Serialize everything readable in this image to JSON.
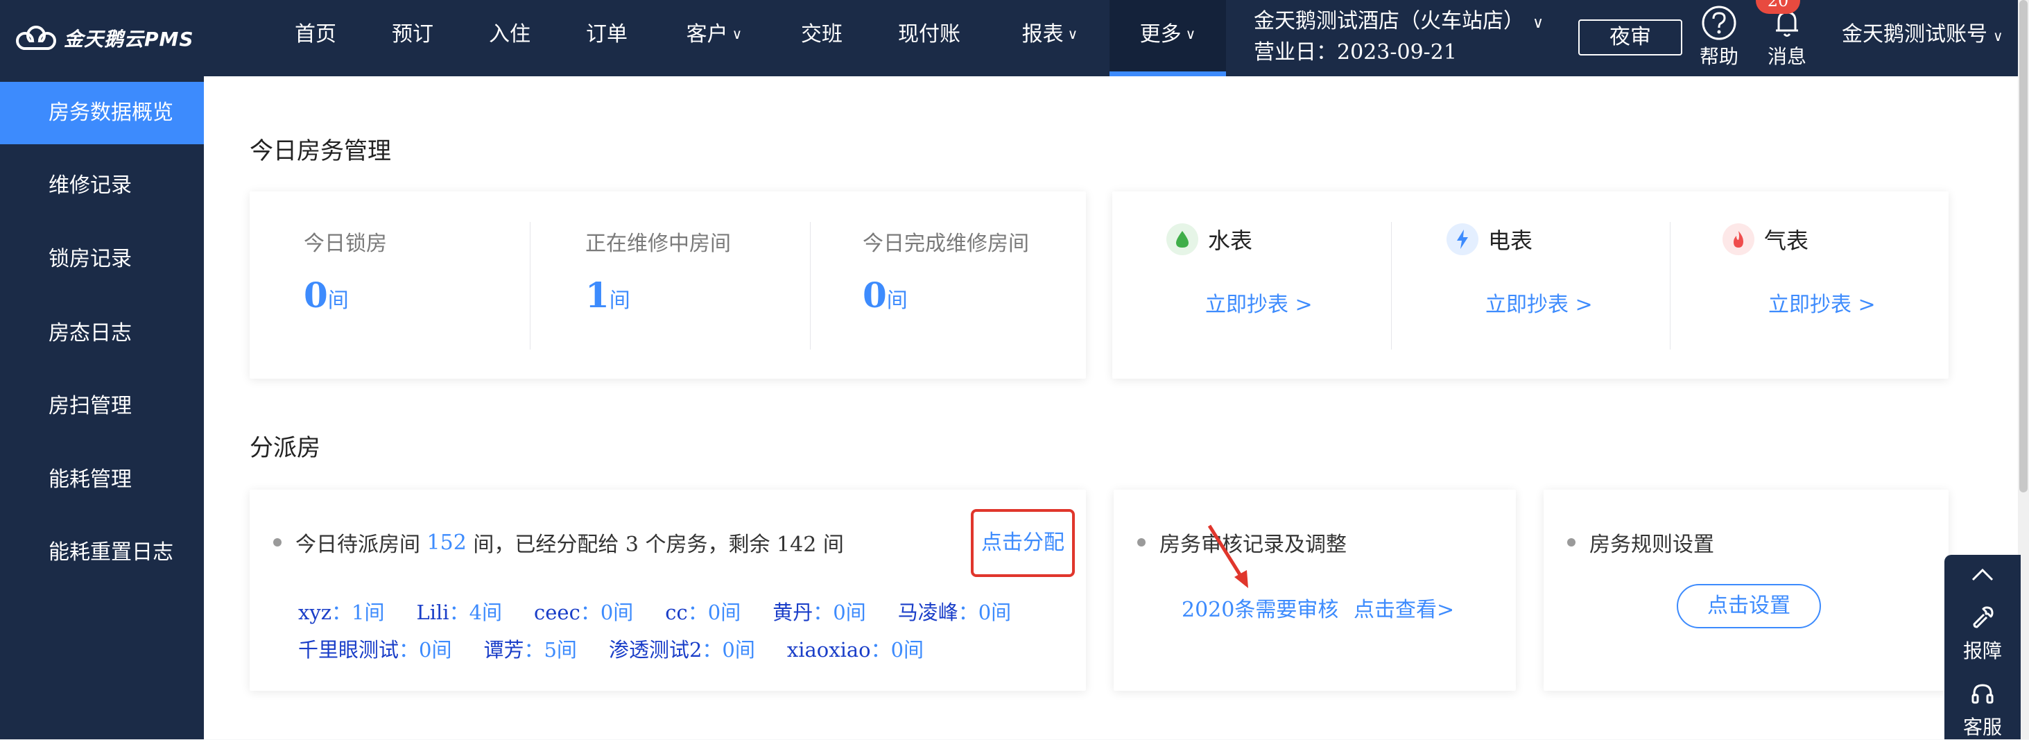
{
  "brand": {
    "logo_text": "金天鹅云PMS",
    "logo_icon": "cloud-logo-icon"
  },
  "nav": {
    "items": [
      {
        "label": "首页",
        "has_dropdown": false
      },
      {
        "label": "预订",
        "has_dropdown": false
      },
      {
        "label": "入住",
        "has_dropdown": false
      },
      {
        "label": "订单",
        "has_dropdown": false
      },
      {
        "label": "客户",
        "has_dropdown": true
      },
      {
        "label": "交班",
        "has_dropdown": false
      },
      {
        "label": "现付账",
        "has_dropdown": false
      },
      {
        "label": "报表",
        "has_dropdown": true
      },
      {
        "label": "更多",
        "has_dropdown": true,
        "active": true
      }
    ],
    "dropdown_glyph": "∨"
  },
  "header": {
    "hotel_name": "金天鹅测试酒店（火车站店）",
    "business_day": "营业日：2023-09-21",
    "audit_label": "夜审",
    "help_label": "帮助",
    "messages_label": "消息",
    "messages_badge": "20",
    "account_label": "金天鹅测试账号"
  },
  "sidebar": {
    "items": [
      {
        "label": "房务数据概览",
        "active": true
      },
      {
        "label": "维修记录"
      },
      {
        "label": "锁房记录"
      },
      {
        "label": "房态日志"
      },
      {
        "label": "房扫管理"
      },
      {
        "label": "能耗管理"
      },
      {
        "label": "能耗重置日志"
      }
    ]
  },
  "today": {
    "title": "今日房务管理",
    "stats": [
      {
        "label": "今日锁房",
        "value": "0",
        "unit": "间"
      },
      {
        "label": "正在维修中房间",
        "value": "1",
        "unit": "间"
      },
      {
        "label": "今日完成维修房间",
        "value": "0",
        "unit": "间"
      }
    ],
    "meters": [
      {
        "label": "水表",
        "icon": "water-drop-icon",
        "link": "立即抄表 >",
        "icon_color": "#3fae49",
        "icon_bg": "#e6f5e7"
      },
      {
        "label": "电表",
        "icon": "lightning-icon",
        "link": "立即抄表 >",
        "icon_color": "#3d8bfd",
        "icon_bg": "#e4efff"
      },
      {
        "label": "气表",
        "icon": "flame-icon",
        "link": "立即抄表 >",
        "icon_color": "#ef4d4d",
        "icon_bg": "#fde8e8"
      }
    ]
  },
  "dispatch": {
    "title": "分派房",
    "summary_prefix": "今日待派房间",
    "pending": "152",
    "summary_suffix": "间，已经分配给 3 个房务，剩余 142 间",
    "assign_link": "点击分配",
    "staff_rows": [
      [
        {
          "name": "xyz",
          "count": "：1间"
        },
        {
          "name": "Lili",
          "count": "：4间"
        },
        {
          "name": "ceec",
          "count": "：0间"
        },
        {
          "name": "cc",
          "count": "：0间"
        },
        {
          "name": "黄丹",
          "count": "：0间"
        },
        {
          "name": "马凌峰",
          "count": "：0间"
        }
      ],
      [
        {
          "name": "千里眼测试",
          "count": "：0间"
        },
        {
          "name": "谭芳",
          "count": "：5间"
        },
        {
          "name": "渗透测试2",
          "count": "：0间"
        },
        {
          "name": "xiaoxiao",
          "count": "：0间"
        }
      ]
    ],
    "review_title": "房务审核记录及调整",
    "review_count": "2020条需要审核",
    "review_link": "点击查看>",
    "rules_title": "房务规则设置",
    "rules_button": "点击设置"
  },
  "float_panel": {
    "up_icon": "chevron-up-icon",
    "report_label": "报障",
    "report_icon": "wrench-icon",
    "service_label": "客服",
    "service_icon": "headset-icon"
  },
  "colors": {
    "nav_bg": "#1b2b47",
    "accent": "#3d8bfd",
    "highlight": "#e0362c"
  }
}
